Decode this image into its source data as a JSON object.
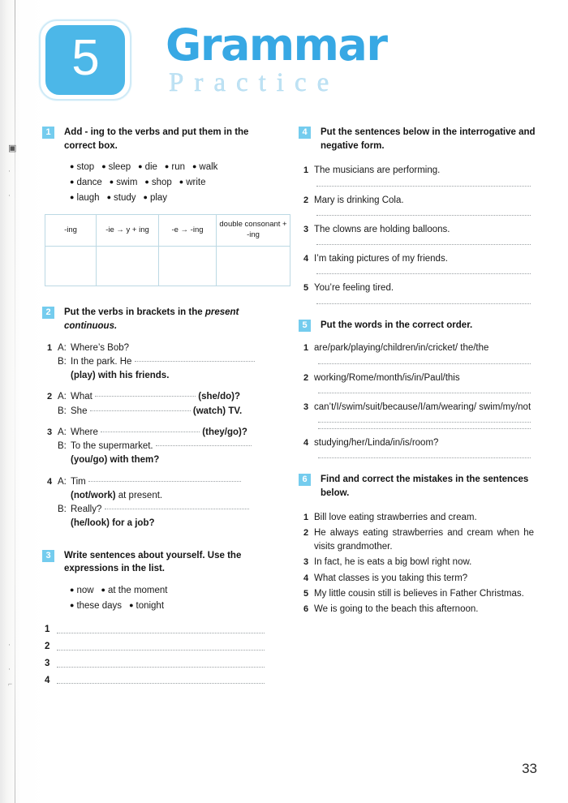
{
  "page": {
    "number": "33",
    "unit_number": "5",
    "title_main": "Grammar",
    "title_sub": "Practice",
    "accent_color": "#4cb7e8",
    "badge_color": "#74ccee",
    "subtitle_color": "#bfe2f4"
  },
  "exercises": [
    {
      "number": "1",
      "title": "Add - ing to the verbs and put them in the correct box.",
      "wordbank": [
        [
          "stop",
          "sleep",
          "die",
          "run",
          "walk"
        ],
        [
          "dance",
          "swim",
          "shop",
          "write"
        ],
        [
          "laugh",
          "study",
          "play"
        ]
      ],
      "table_headers": [
        "-ing",
        "-ie → y + ing",
        "-e → -ing",
        "double consonant + -ing"
      ],
      "table_blank_row": [
        "",
        "",
        "",
        ""
      ]
    },
    {
      "number": "2",
      "title_pre": "Put the verbs in brackets in the ",
      "title_em": "present continuous.",
      "items": [
        {
          "n": "1",
          "lines": [
            {
              "speaker": "A:",
              "text": "Where’s Bob?"
            },
            {
              "speaker": "B:",
              "text": "In the park. He",
              "dots": true
            },
            {
              "speaker": "",
              "text": "(play) with his friends.",
              "bold": true
            }
          ]
        },
        {
          "n": "2",
          "lines": [
            {
              "speaker": "A:",
              "text": "What",
              "dots": true,
              "tail": "(she/do)?",
              "tail_bold": true
            },
            {
              "speaker": "B:",
              "text": "She",
              "dots": true,
              "tail": "(watch) TV.",
              "tail_bold": true
            }
          ]
        },
        {
          "n": "3",
          "lines": [
            {
              "speaker": "A:",
              "text": "Where",
              "dots": true,
              "tail": "(they/go)?",
              "tail_bold": true
            },
            {
              "speaker": "B:",
              "text": "To the supermarket.",
              "dots": true
            },
            {
              "speaker": "",
              "text": "(you/go) with them?",
              "bold": true
            }
          ]
        },
        {
          "n": "4",
          "lines": [
            {
              "speaker": "A:",
              "text": "Tim",
              "dots": true
            },
            {
              "speaker": "",
              "text": "(not/work) at present.",
              "bold_prefix": "(not/work)",
              "rest": " at present."
            },
            {
              "speaker": "B:",
              "text": "Really?",
              "dots": true
            },
            {
              "speaker": "",
              "text": "(he/look) for a job?",
              "bold": true
            }
          ]
        }
      ]
    },
    {
      "number": "3",
      "title": "Write sentences about yourself. Use the expressions in the list.",
      "wordbank": [
        [
          "now",
          "at the moment"
        ],
        [
          "these days",
          "tonight"
        ]
      ],
      "answer_numbers": [
        "1",
        "2",
        "3",
        "4"
      ]
    },
    {
      "number": "4",
      "title": "Put the sentences below in the interrogative and negative form.",
      "items": [
        {
          "n": "1",
          "text": "The musicians are performing."
        },
        {
          "n": "2",
          "text": "Mary is drinking Cola."
        },
        {
          "n": "3",
          "text": "The clowns are holding balloons."
        },
        {
          "n": "4",
          "text": "I’m taking pictures of my friends."
        },
        {
          "n": "5",
          "text": "You’re feeling tired."
        }
      ]
    },
    {
      "number": "5",
      "title": "Put the words in the correct order.",
      "items": [
        {
          "n": "1",
          "text": "are/park/playing/children/in/cricket/ the/the",
          "lines": 1
        },
        {
          "n": "2",
          "text": "working/Rome/month/is/in/Paul/this",
          "lines": 1
        },
        {
          "n": "3",
          "text": "can’t/I/swim/suit/because/I/am/wearing/ swim/my/not",
          "lines": 2
        },
        {
          "n": "4",
          "text": "studying/her/Linda/in/is/room?",
          "lines": 1
        }
      ]
    },
    {
      "number": "6",
      "title": "Find and correct the mistakes in the sentences below.",
      "items": [
        {
          "n": "1",
          "text": "Bill love eating strawberries and cream."
        },
        {
          "n": "2",
          "text": "He always eating strawberries and cream when he visits grandmother."
        },
        {
          "n": "3",
          "text": "In fact, he is eats a big bowl right now."
        },
        {
          "n": "4",
          "text": "What classes is you taking this term?"
        },
        {
          "n": "5",
          "text": "My little cousin still is believes in Father Christmas."
        },
        {
          "n": "6",
          "text": "We is going to the beach this afternoon."
        }
      ]
    }
  ]
}
